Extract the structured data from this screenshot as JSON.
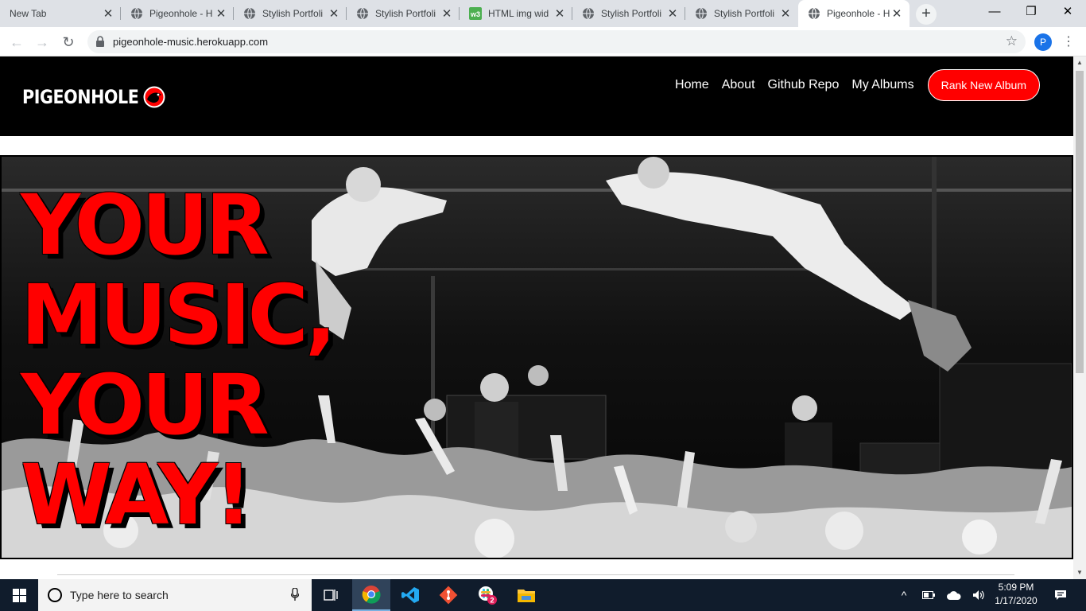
{
  "browser": {
    "tabs": [
      {
        "title": "New Tab",
        "favicon": "none",
        "active": false
      },
      {
        "title": "Pigeonhole - H",
        "favicon": "globe-icon",
        "active": false
      },
      {
        "title": "Stylish Portfoli",
        "favicon": "globe-icon",
        "active": false
      },
      {
        "title": "Stylish Portfoli",
        "favicon": "globe-icon",
        "active": false
      },
      {
        "title": "HTML img wid",
        "favicon": "w3schools-icon",
        "active": false
      },
      {
        "title": "Stylish Portfoli",
        "favicon": "globe-icon",
        "active": false
      },
      {
        "title": "Stylish Portfoli",
        "favicon": "globe-icon",
        "active": false
      },
      {
        "title": "Pigeonhole - H",
        "favicon": "globe-icon",
        "active": true
      }
    ],
    "close_glyph": "✕",
    "new_tab_glyph": "+",
    "window_controls": {
      "minimize": "—",
      "maximize": "❐",
      "close": "✕"
    },
    "nav": {
      "back": "←",
      "forward": "→",
      "reload": "↻"
    },
    "url": "pigeonhole-music.herokuapp.com",
    "bookmark_star": "☆",
    "profile_initial": "P",
    "menu_glyph": "⋮"
  },
  "site": {
    "logo_text": "PIGEONHOLE",
    "nav_links": [
      {
        "label": "Home"
      },
      {
        "label": "About"
      },
      {
        "label": "Github Repo"
      },
      {
        "label": "My Albums"
      }
    ],
    "cta_label": "Rank New Album",
    "hero_lines": [
      "YOUR",
      "MUSIC,",
      "YOUR",
      "WAY!"
    ],
    "colors": {
      "brand_red": "#ff0000",
      "nav_bg": "#000000"
    }
  },
  "taskbar": {
    "search_placeholder": "Type here to search",
    "apps": [
      "task-view-icon",
      "chrome-icon",
      "vscode-icon",
      "git-icon",
      "slack-icon",
      "file-explorer-icon"
    ],
    "slack_badge": "2",
    "tray_up": "^",
    "time": "5:09 PM",
    "date": "1/17/2020"
  }
}
